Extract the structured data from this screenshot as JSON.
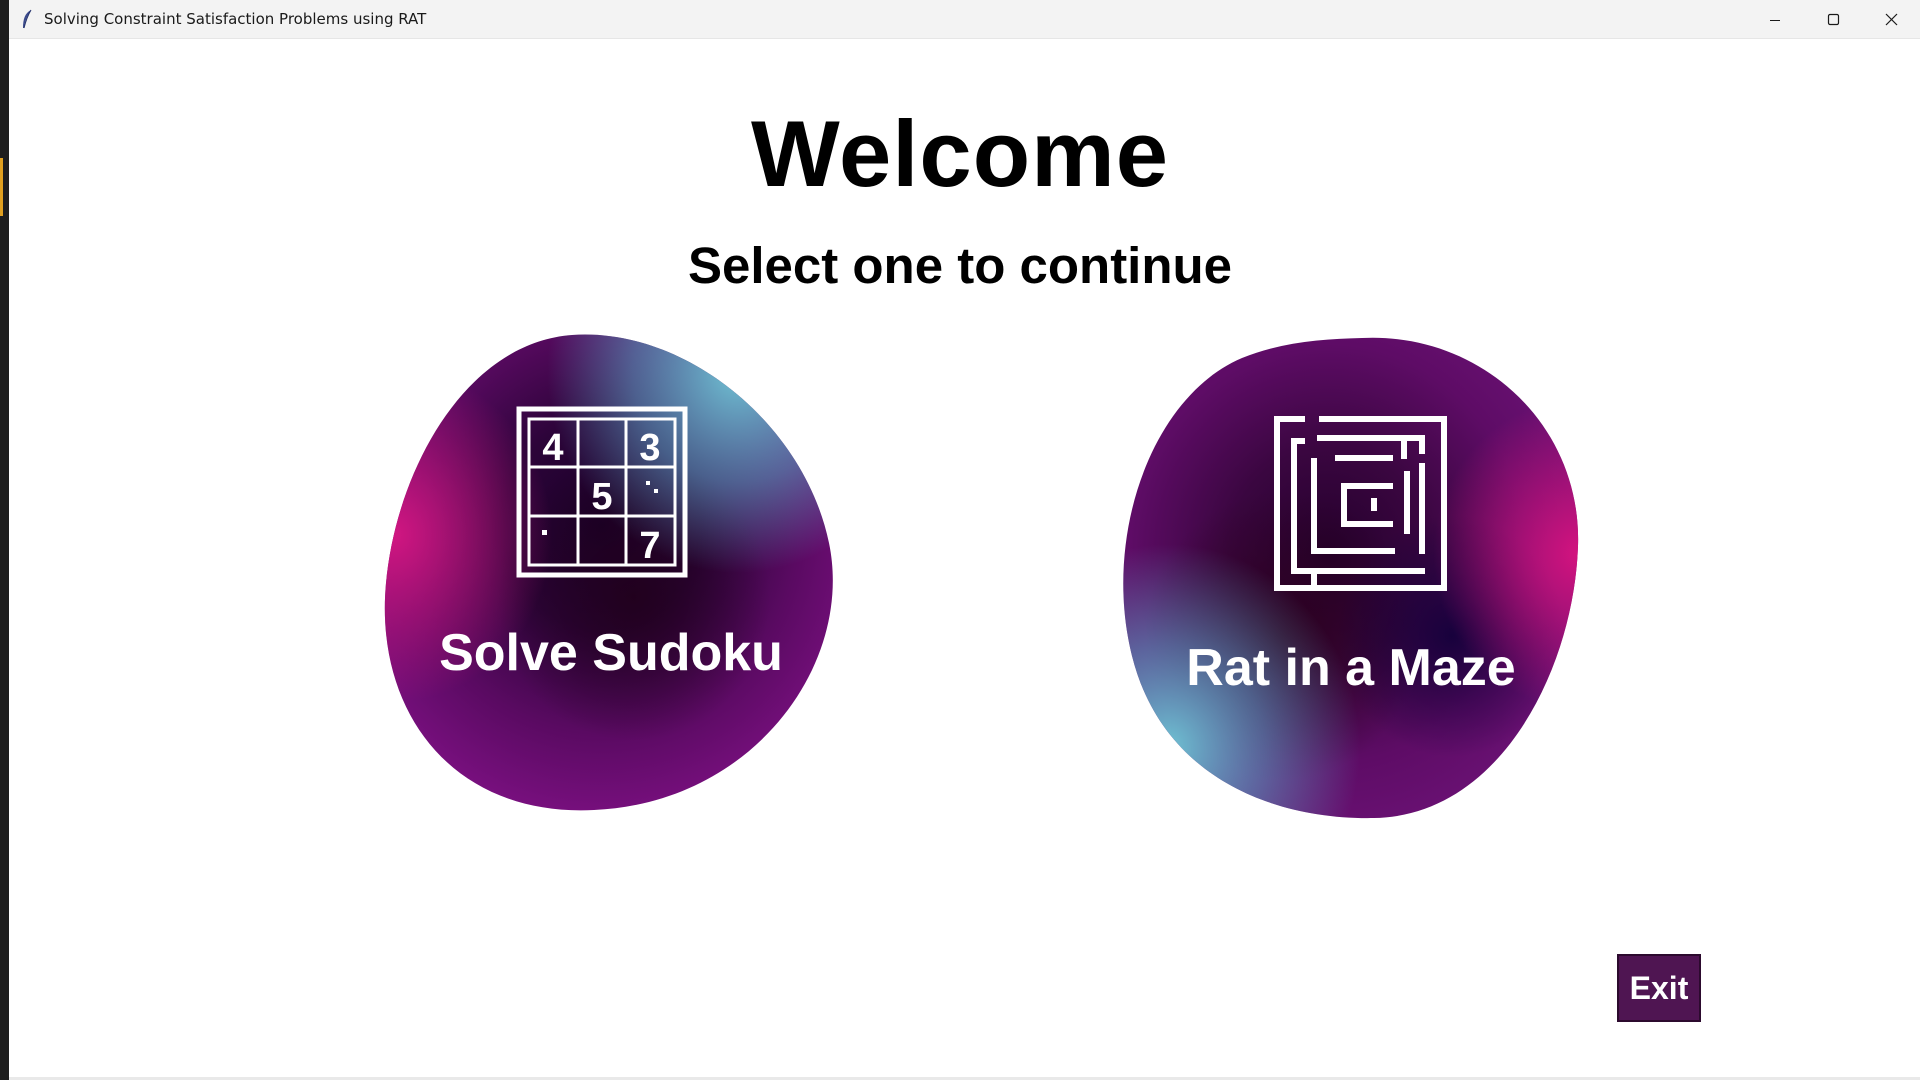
{
  "window": {
    "title": "Solving Constraint Satisfaction Problems using RAT",
    "app_icon": "feather-icon",
    "controls": [
      "minimize-icon",
      "maximize-icon",
      "close-icon"
    ]
  },
  "main": {
    "heading": "Welcome",
    "subheading": "Select one to continue",
    "options": [
      {
        "label": "Solve Sudoku",
        "icon": "sudoku-grid-icon",
        "grid_digits": [
          "4",
          "3",
          "5",
          "7"
        ]
      },
      {
        "label": "Rat in a Maze",
        "icon": "maze-icon"
      }
    ],
    "exit_label": "Exit"
  },
  "colors": {
    "accent_purple": "#4f1552",
    "blob_magenta": "#c0137a",
    "blob_deep": "#1a0033",
    "blob_cyan": "#62b6cb"
  }
}
